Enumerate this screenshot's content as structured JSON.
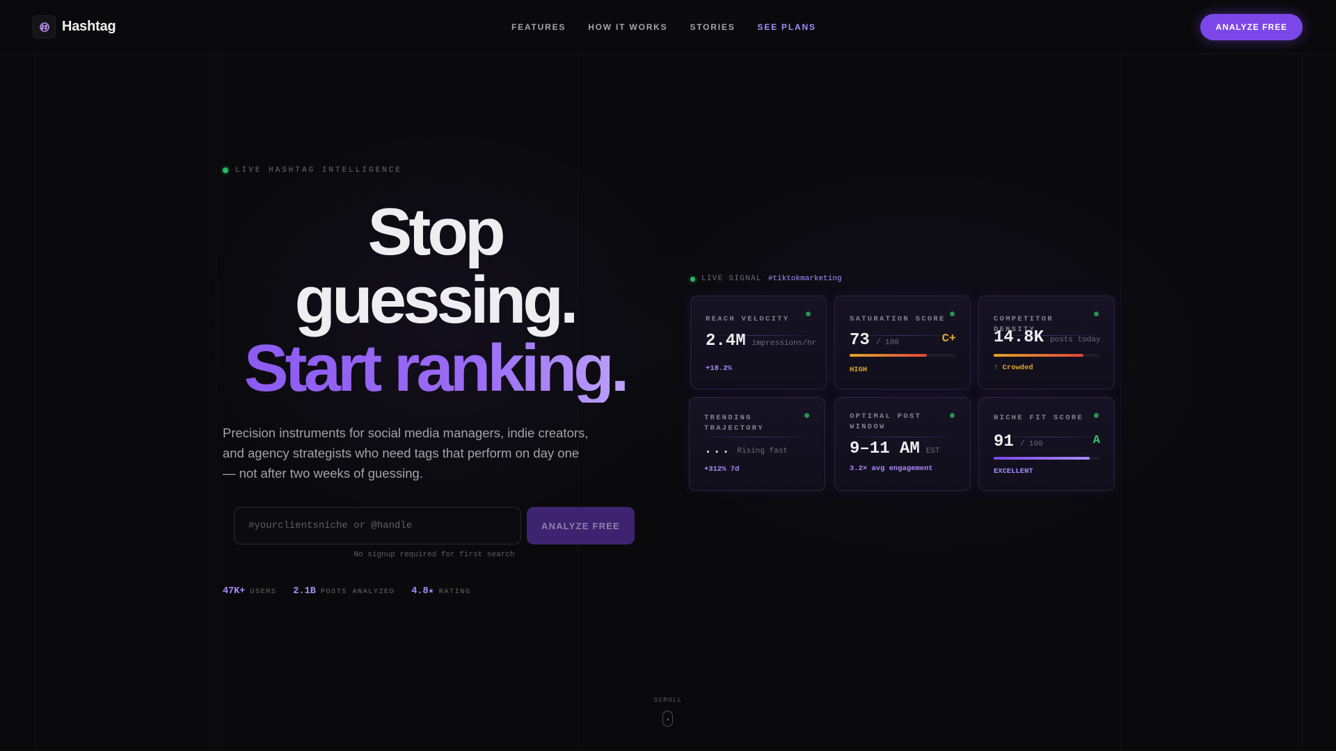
{
  "nav": {
    "brand": "Hashtag",
    "links": [
      "FEATURES",
      "HOW IT WORKS",
      "STORIES",
      "SEE PLANS"
    ],
    "cta": "ANALYZE FREE"
  },
  "hero": {
    "eyebrow": "LIVE HASHTAG INTELLIGENCE",
    "headline_line1": "Stop",
    "headline_line2": "guessing.",
    "headline_line3": "Start ranking.",
    "subtext": "Precision instruments for social media managers, indie creators, and agency strategists who need tags that perform on day one — not after two weeks of guessing.",
    "search_placeholder": "#yourclientsniche or @handle",
    "search_button": "ANALYZE FREE",
    "hint": "No signup required for first search",
    "stats": [
      {
        "value": "47K+",
        "label": "USERS"
      },
      {
        "value": "2.1B",
        "label": "POSTS ANALYZED"
      },
      {
        "value": "4.8★",
        "label": "RATING"
      }
    ]
  },
  "signal": {
    "label": "LIVE SIGNAL",
    "tag": "#tiktokmarketing"
  },
  "cards": {
    "reach": {
      "title": "REACH VELOCITY",
      "value": "2.4M",
      "unit": "impressions/hr",
      "foot": "+18.2%"
    },
    "saturation": {
      "title": "SATURATION SCORE",
      "value": "73",
      "unit": "/ 100",
      "grade": "C+",
      "foot": "HIGH",
      "level": 0.73
    },
    "competitor": {
      "title": "COMPETITOR DENSITY",
      "value": "14.8K",
      "unit": "posts today",
      "foot": "↑ Crowded",
      "level": 0.85
    },
    "trending": {
      "title": "TRENDING TRAJECTORY",
      "value": "...",
      "unit": "Rising fast",
      "foot": "+312% 7d"
    },
    "optimal": {
      "title": "OPTIMAL POST WINDOW",
      "value": "9–11 AM",
      "unit": "EST",
      "foot": "3.2× avg engagement"
    },
    "niche": {
      "title": "NICHE FIT SCORE",
      "value": "91",
      "unit": "/ 100",
      "grade": "A",
      "foot": "EXCELLENT",
      "level": 0.91
    }
  },
  "colors": {
    "accent": "#7c47e8",
    "accent_text": "#a98cff",
    "live_green": "#2db86a",
    "warning": "#e0a52c",
    "danger": "#e0463a",
    "grade_good": "#35c46e"
  },
  "scroll": {
    "label": "SCROLL"
  }
}
